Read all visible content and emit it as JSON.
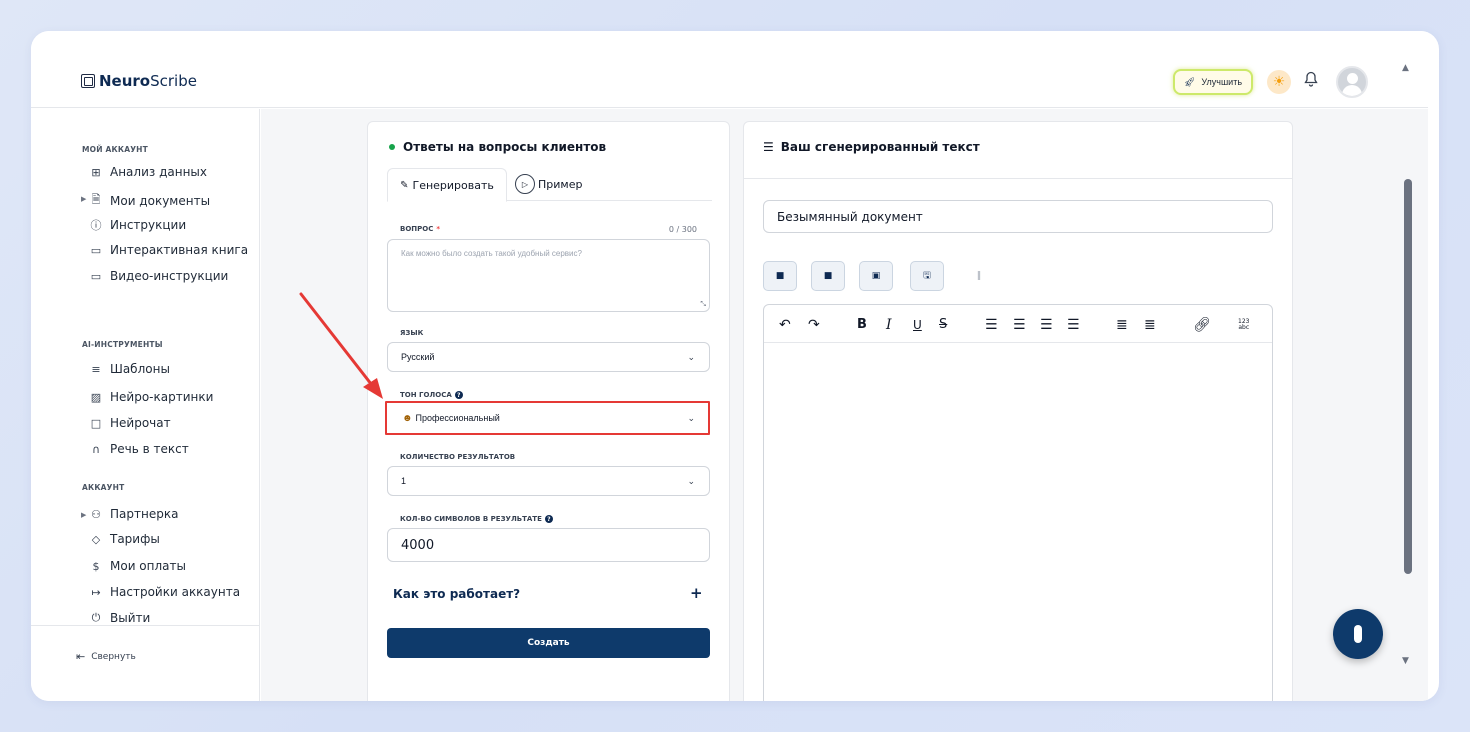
{
  "header": {
    "logo_bold": "Neuro",
    "logo_rest": "Scribe",
    "upgrade_label": "Улучшить"
  },
  "sidebar": {
    "section_my_account": "МОЙ АККАУНТ",
    "my_account_items": [
      {
        "label": "Анализ данных",
        "icon": "grid-icon"
      },
      {
        "label": "Мои документы",
        "icon": "document-icon"
      },
      {
        "label": "Инструкции",
        "icon": "help-circle-icon"
      },
      {
        "label": "Интерактивная книга",
        "icon": "book-icon"
      },
      {
        "label": "Видео-инструкции",
        "icon": "video-icon"
      }
    ],
    "section_ai_tools": "AI-ИНСТРУМЕНТЫ",
    "ai_items": [
      {
        "label": "Шаблоны",
        "icon": "layers-icon"
      },
      {
        "label": "Нейро-картинки",
        "icon": "image-icon"
      },
      {
        "label": "Нейрочат",
        "icon": "chat-icon"
      },
      {
        "label": "Речь в текст",
        "icon": "headphones-icon"
      }
    ],
    "section_account": "АККАУНТ",
    "account_items": [
      {
        "label": "Партнерка",
        "icon": "users-icon"
      },
      {
        "label": "Тарифы",
        "icon": "tag-icon"
      },
      {
        "label": "Мои оплаты",
        "icon": "dollar-icon"
      },
      {
        "label": "Настройки аккаунта",
        "icon": "logout-arrow-icon"
      },
      {
        "label": "Выйти",
        "icon": "power-icon"
      }
    ],
    "collapse_label": "Свернуть"
  },
  "form": {
    "title": "Ответы на вопросы клиентов",
    "tab_generate": "Генерировать",
    "tab_example": "Пример",
    "question_label": "ВОПРОС",
    "question_required": "*",
    "question_counter": "0 / 300",
    "question_placeholder": "Как можно было создать такой удобный сервис?",
    "language_label": "ЯЗЫК",
    "language_value": "Русский",
    "tone_label": "ТОН ГОЛОСА",
    "tone_value": "Профессиональный",
    "results_label": "КОЛИЧЕСТВО РЕЗУЛЬТАТОВ",
    "results_value": "1",
    "chars_label": "КОЛ-ВО СИМВОЛОВ В РЕЗУЛЬТАТЕ",
    "chars_value": "4000",
    "how_label": "Как это работает?",
    "create_label": "Создать"
  },
  "output": {
    "title": "Ваш сгенерированный текст",
    "doc_name": "Безымянный документ",
    "toolbar_abc_top": "123",
    "toolbar_abc_bottom": "abc"
  },
  "colors": {
    "brand": "#0e3a6b",
    "highlight": "#e53935",
    "status_dot": "#16a34a"
  }
}
